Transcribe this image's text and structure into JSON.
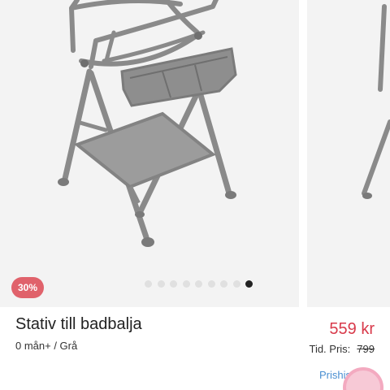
{
  "gallery": {
    "discount_badge": "30%",
    "dot_count": 9,
    "active_dot": 8
  },
  "product": {
    "title": "Stativ till badbalja",
    "subtitle": "0 mån+ / Grå",
    "price": "559 kr",
    "previous_price_label": "Tid. Pris:",
    "previous_price": "799",
    "price_history_link": "Prishis"
  },
  "colors": {
    "accent_red": "#d8394a",
    "badge_red": "#e0626b",
    "link_blue": "#4a8fd1"
  }
}
